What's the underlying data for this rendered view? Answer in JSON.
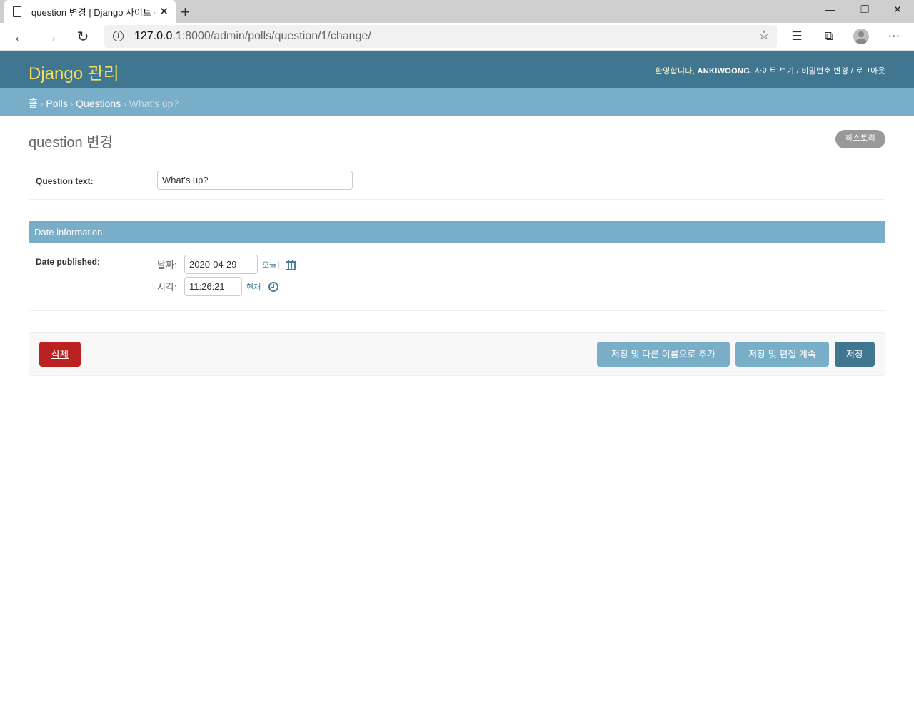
{
  "browser": {
    "tab_title": "question 변경 | Django 사이트 관",
    "tab_close": "✕",
    "new_tab": "+",
    "url_host": "127.0.0.1",
    "url_rest": ":8000/admin/polls/question/1/change/",
    "win_min": "—",
    "win_max": "❐",
    "win_close": "✕"
  },
  "header": {
    "brand": "Django 관리",
    "welcome": "환영합니다,",
    "username": "ANKIWOONG",
    "dot": ".",
    "view_site": "사이트 보기",
    "change_password": "비밀번호 변경",
    "logout": "로그아웃",
    "slash": "/"
  },
  "breadcrumbs": {
    "home": "홈",
    "app": "Polls",
    "model": "Questions",
    "current": "What's up?",
    "sep": "›"
  },
  "page": {
    "title": "question 변경",
    "history": "히스토리"
  },
  "form": {
    "question_text_label": "Question text:",
    "question_text_value": "What's up?",
    "fieldset_title": "Date information",
    "date_published_label": "Date published:",
    "date_label": "날짜:",
    "date_value": "2020-04-29",
    "today_link": "오늘",
    "time_label": "시각:",
    "time_value": "11:26:21",
    "now_link": "현재",
    "pipe": "|"
  },
  "actions": {
    "delete": "삭제",
    "save_add_another": "저장 및 다른 이름으로 추가",
    "save_continue": "저장 및 편집 계속",
    "save": "저장"
  },
  "colors": {
    "header_bg": "#417690",
    "brand": "#f5dd5d",
    "breadcrumb_bg": "#79aec8",
    "delete": "#ba2121"
  }
}
